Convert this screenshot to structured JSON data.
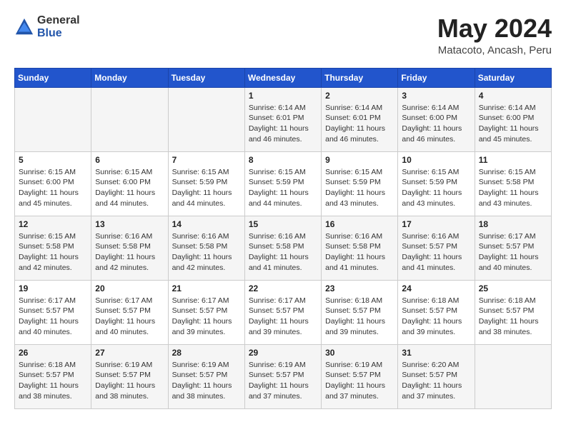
{
  "logo": {
    "general": "General",
    "blue": "Blue"
  },
  "header": {
    "month": "May 2024",
    "location": "Matacoto, Ancash, Peru"
  },
  "weekdays": [
    "Sunday",
    "Monday",
    "Tuesday",
    "Wednesday",
    "Thursday",
    "Friday",
    "Saturday"
  ],
  "weeks": [
    [
      {
        "day": "",
        "info": ""
      },
      {
        "day": "",
        "info": ""
      },
      {
        "day": "",
        "info": ""
      },
      {
        "day": "1",
        "info": "Sunrise: 6:14 AM\nSunset: 6:01 PM\nDaylight: 11 hours and 46 minutes."
      },
      {
        "day": "2",
        "info": "Sunrise: 6:14 AM\nSunset: 6:01 PM\nDaylight: 11 hours and 46 minutes."
      },
      {
        "day": "3",
        "info": "Sunrise: 6:14 AM\nSunset: 6:00 PM\nDaylight: 11 hours and 46 minutes."
      },
      {
        "day": "4",
        "info": "Sunrise: 6:14 AM\nSunset: 6:00 PM\nDaylight: 11 hours and 45 minutes."
      }
    ],
    [
      {
        "day": "5",
        "info": "Sunrise: 6:15 AM\nSunset: 6:00 PM\nDaylight: 11 hours and 45 minutes."
      },
      {
        "day": "6",
        "info": "Sunrise: 6:15 AM\nSunset: 6:00 PM\nDaylight: 11 hours and 44 minutes."
      },
      {
        "day": "7",
        "info": "Sunrise: 6:15 AM\nSunset: 5:59 PM\nDaylight: 11 hours and 44 minutes."
      },
      {
        "day": "8",
        "info": "Sunrise: 6:15 AM\nSunset: 5:59 PM\nDaylight: 11 hours and 44 minutes."
      },
      {
        "day": "9",
        "info": "Sunrise: 6:15 AM\nSunset: 5:59 PM\nDaylight: 11 hours and 43 minutes."
      },
      {
        "day": "10",
        "info": "Sunrise: 6:15 AM\nSunset: 5:59 PM\nDaylight: 11 hours and 43 minutes."
      },
      {
        "day": "11",
        "info": "Sunrise: 6:15 AM\nSunset: 5:58 PM\nDaylight: 11 hours and 43 minutes."
      }
    ],
    [
      {
        "day": "12",
        "info": "Sunrise: 6:15 AM\nSunset: 5:58 PM\nDaylight: 11 hours and 42 minutes."
      },
      {
        "day": "13",
        "info": "Sunrise: 6:16 AM\nSunset: 5:58 PM\nDaylight: 11 hours and 42 minutes."
      },
      {
        "day": "14",
        "info": "Sunrise: 6:16 AM\nSunset: 5:58 PM\nDaylight: 11 hours and 42 minutes."
      },
      {
        "day": "15",
        "info": "Sunrise: 6:16 AM\nSunset: 5:58 PM\nDaylight: 11 hours and 41 minutes."
      },
      {
        "day": "16",
        "info": "Sunrise: 6:16 AM\nSunset: 5:58 PM\nDaylight: 11 hours and 41 minutes."
      },
      {
        "day": "17",
        "info": "Sunrise: 6:16 AM\nSunset: 5:57 PM\nDaylight: 11 hours and 41 minutes."
      },
      {
        "day": "18",
        "info": "Sunrise: 6:17 AM\nSunset: 5:57 PM\nDaylight: 11 hours and 40 minutes."
      }
    ],
    [
      {
        "day": "19",
        "info": "Sunrise: 6:17 AM\nSunset: 5:57 PM\nDaylight: 11 hours and 40 minutes."
      },
      {
        "day": "20",
        "info": "Sunrise: 6:17 AM\nSunset: 5:57 PM\nDaylight: 11 hours and 40 minutes."
      },
      {
        "day": "21",
        "info": "Sunrise: 6:17 AM\nSunset: 5:57 PM\nDaylight: 11 hours and 39 minutes."
      },
      {
        "day": "22",
        "info": "Sunrise: 6:17 AM\nSunset: 5:57 PM\nDaylight: 11 hours and 39 minutes."
      },
      {
        "day": "23",
        "info": "Sunrise: 6:18 AM\nSunset: 5:57 PM\nDaylight: 11 hours and 39 minutes."
      },
      {
        "day": "24",
        "info": "Sunrise: 6:18 AM\nSunset: 5:57 PM\nDaylight: 11 hours and 39 minutes."
      },
      {
        "day": "25",
        "info": "Sunrise: 6:18 AM\nSunset: 5:57 PM\nDaylight: 11 hours and 38 minutes."
      }
    ],
    [
      {
        "day": "26",
        "info": "Sunrise: 6:18 AM\nSunset: 5:57 PM\nDaylight: 11 hours and 38 minutes."
      },
      {
        "day": "27",
        "info": "Sunrise: 6:19 AM\nSunset: 5:57 PM\nDaylight: 11 hours and 38 minutes."
      },
      {
        "day": "28",
        "info": "Sunrise: 6:19 AM\nSunset: 5:57 PM\nDaylight: 11 hours and 38 minutes."
      },
      {
        "day": "29",
        "info": "Sunrise: 6:19 AM\nSunset: 5:57 PM\nDaylight: 11 hours and 37 minutes."
      },
      {
        "day": "30",
        "info": "Sunrise: 6:19 AM\nSunset: 5:57 PM\nDaylight: 11 hours and 37 minutes."
      },
      {
        "day": "31",
        "info": "Sunrise: 6:20 AM\nSunset: 5:57 PM\nDaylight: 11 hours and 37 minutes."
      },
      {
        "day": "",
        "info": ""
      }
    ]
  ]
}
